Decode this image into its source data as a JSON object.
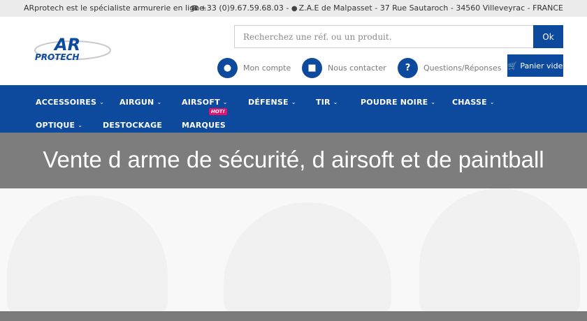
{
  "topbar": {
    "tagline": "ARprotech est le spécialiste armurerie en ligne.",
    "phone": "+33 (0)9.67.59.68.03",
    "address": "Z.A.E de Malpasset - 37 Rue Sautaroch - 34560 Villeveyrac - FRANCE"
  },
  "header": {
    "logo_text": "AR PROTECH",
    "search": {
      "placeholder": "Recherchez une réf. ou un produit.",
      "button_label": "Ok"
    },
    "links": [
      {
        "label": "Mon compte",
        "icon": "user-icon"
      },
      {
        "label": "Nous contacter",
        "icon": "chat-icon"
      },
      {
        "label": "Questions/Réponses",
        "icon": "question-icon"
      }
    ],
    "cart_label": "Panier vide"
  },
  "nav": {
    "row1": [
      "ACCESSOIRES",
      "AIRGUN",
      "AIRSOFT",
      "DÉFENSE",
      "TIR",
      "POUDRE NOIRE",
      "CHASSE"
    ],
    "row2": [
      "OPTIQUE",
      "DESTOCKAGE",
      "MARQUES"
    ],
    "hot_badge": "HOT!"
  },
  "hero": {
    "title": "Vente d arme de sécurité, d airsoft et de paintball"
  },
  "colors": {
    "primary": "#0d4a9e",
    "hot": "#e4126f"
  }
}
